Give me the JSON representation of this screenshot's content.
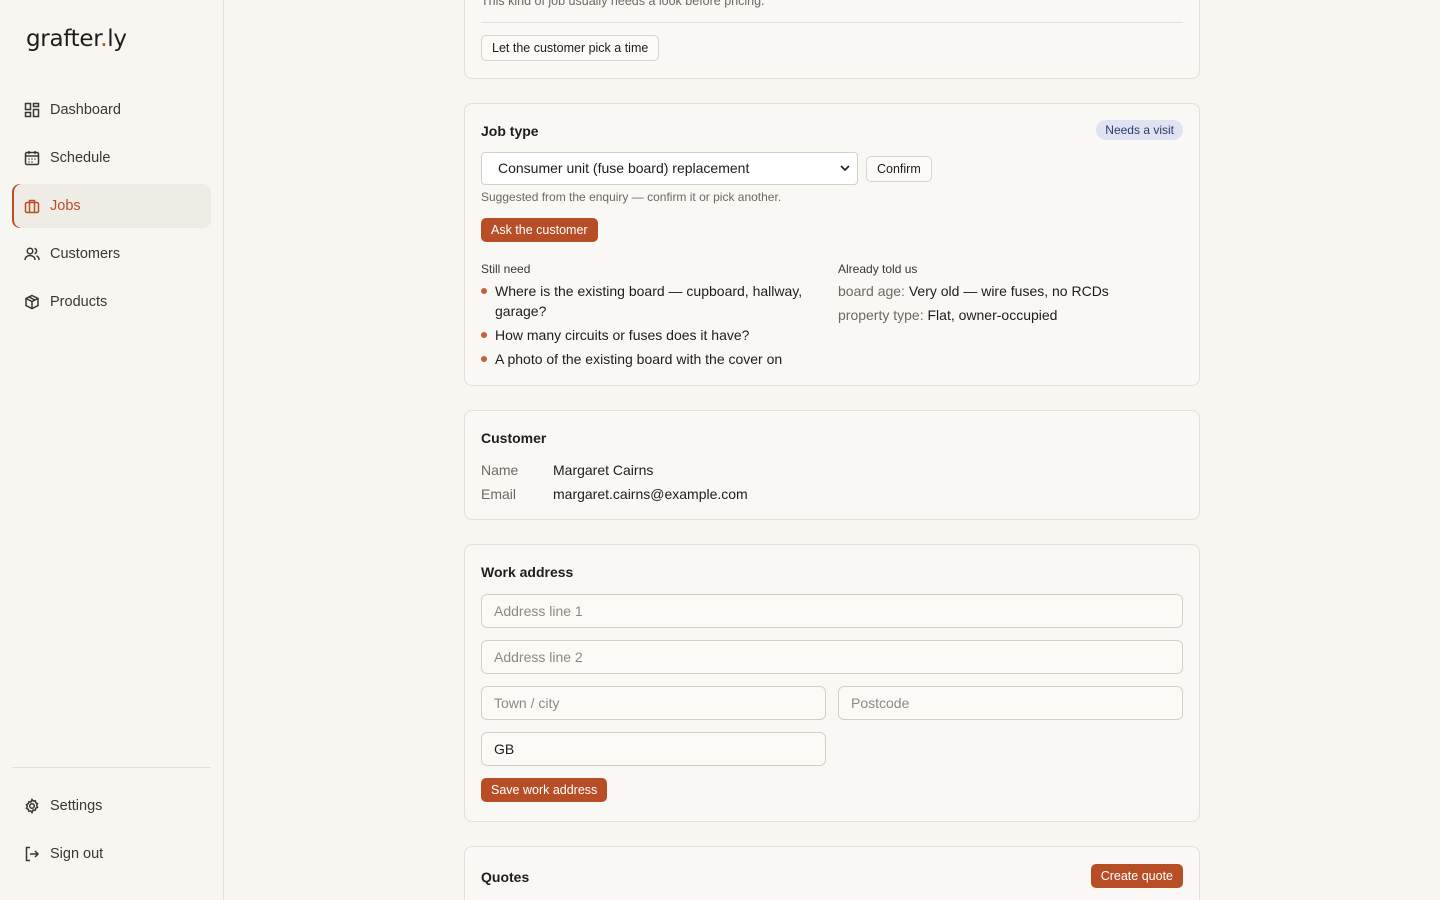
{
  "brand": {
    "name": "grafter",
    "dot": ".",
    "suffix": "ly"
  },
  "nav": {
    "items": [
      {
        "label": "Dashboard",
        "icon": "dashboard-icon"
      },
      {
        "label": "Schedule",
        "icon": "calendar-icon"
      },
      {
        "label": "Jobs",
        "icon": "briefcase-icon",
        "active": true
      },
      {
        "label": "Customers",
        "icon": "users-icon"
      },
      {
        "label": "Products",
        "icon": "box-icon"
      }
    ],
    "bottom": [
      {
        "label": "Settings",
        "icon": "gear-icon"
      },
      {
        "label": "Sign out",
        "icon": "sign-out-icon"
      }
    ]
  },
  "visit_card": {
    "note": "This kind of job usually needs a look before pricing.",
    "button": "Let the customer pick a time"
  },
  "job_type": {
    "title": "Job type",
    "badge": "Needs a visit",
    "selected": "Consumer unit (fuse board) replacement",
    "confirm": "Confirm",
    "hint": "Suggested from the enquiry — confirm it or pick another.",
    "ask_button": "Ask the customer",
    "still_need_label": "Still need",
    "still_need": [
      "Where is the existing board — cupboard, hallway, garage?",
      "How many circuits or fuses does it have?",
      "A photo of the existing board with the cover on"
    ],
    "told_label": "Already told us",
    "told": [
      {
        "key": "board age:",
        "value": "Very old — wire fuses, no RCDs"
      },
      {
        "key": "property type:",
        "value": "Flat, owner-occupied"
      }
    ]
  },
  "customer": {
    "title": "Customer",
    "name_label": "Name",
    "name": "Margaret Cairns",
    "email_label": "Email",
    "email": "margaret.cairns@example.com"
  },
  "address": {
    "title": "Work address",
    "line1_placeholder": "Address line 1",
    "line2_placeholder": "Address line 2",
    "town_placeholder": "Town / city",
    "postcode_placeholder": "Postcode",
    "country": "GB",
    "save": "Save work address"
  },
  "quotes": {
    "title": "Quotes",
    "create": "Create quote"
  },
  "colors": {
    "accent": "#b84e26",
    "badge_bg": "#dfe2f2",
    "background": "#f7f6f1"
  }
}
